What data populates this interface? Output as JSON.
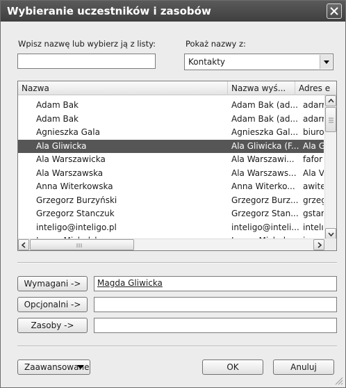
{
  "window": {
    "title": "Wybieranie uczestników i zasobów"
  },
  "search": {
    "label": "Wpisz nazwę lub wybierz ją z listy:",
    "value": ""
  },
  "show_names": {
    "label": "Pokaż nazwy z:",
    "selected": "Kontakty"
  },
  "list": {
    "columns": [
      "Nazwa",
      "Nazwa wyś...",
      "Adres e"
    ],
    "rows": [
      {
        "name": "Adam Bak",
        "display": "Adam Bak (ad...",
        "email": "adarr"
      },
      {
        "name": "Adam Bak",
        "display": "Adam Bak (ad...",
        "email": "adarr"
      },
      {
        "name": "Agnieszka Gala",
        "display": "Agnieszka Gal...",
        "email": "biuro"
      },
      {
        "name": "Ala Gliwicka",
        "display": "Ala Gliwicka (F...",
        "email": "Ala G",
        "selected": true
      },
      {
        "name": "Ala Warszawicka",
        "display": "Ala Warszawi...",
        "email": "fafor"
      },
      {
        "name": "Ala Warszawska",
        "display": "Ala Warszaws...",
        "email": "Ala V"
      },
      {
        "name": "Anna Witerkowska",
        "display": "Anna Witerko...",
        "email": "awite"
      },
      {
        "name": "Grzegorz Burzyński",
        "display": "Grzegorz Burz...",
        "email": "grzeg"
      },
      {
        "name": "Grzegorz Stanczuk",
        "display": "Grzegorz Stan...",
        "email": "gstar"
      },
      {
        "name": "inteligo@inteligo.pl",
        "display": "inteligo@inteli...",
        "email": "intelı"
      },
      {
        "name": "Iwona Michalska",
        "display": "Iwona Michals...",
        "email": "iwon"
      }
    ]
  },
  "recipients": {
    "required_label": "Wymagani ->",
    "required_value": "Magda Gliwicka",
    "optional_label": "Opcjonalni ->",
    "optional_value": "",
    "resources_label": "Zasoby ->",
    "resources_value": ""
  },
  "footer": {
    "advanced_label": "Zaawansowane",
    "ok_label": "OK",
    "cancel_label": "Anuluj"
  },
  "icons": [
    "close-icon",
    "dropdown-arrow-icon",
    "scroll-up-icon",
    "scroll-down-icon",
    "scroll-left-icon",
    "scroll-right-icon",
    "resize-grip-icon"
  ]
}
